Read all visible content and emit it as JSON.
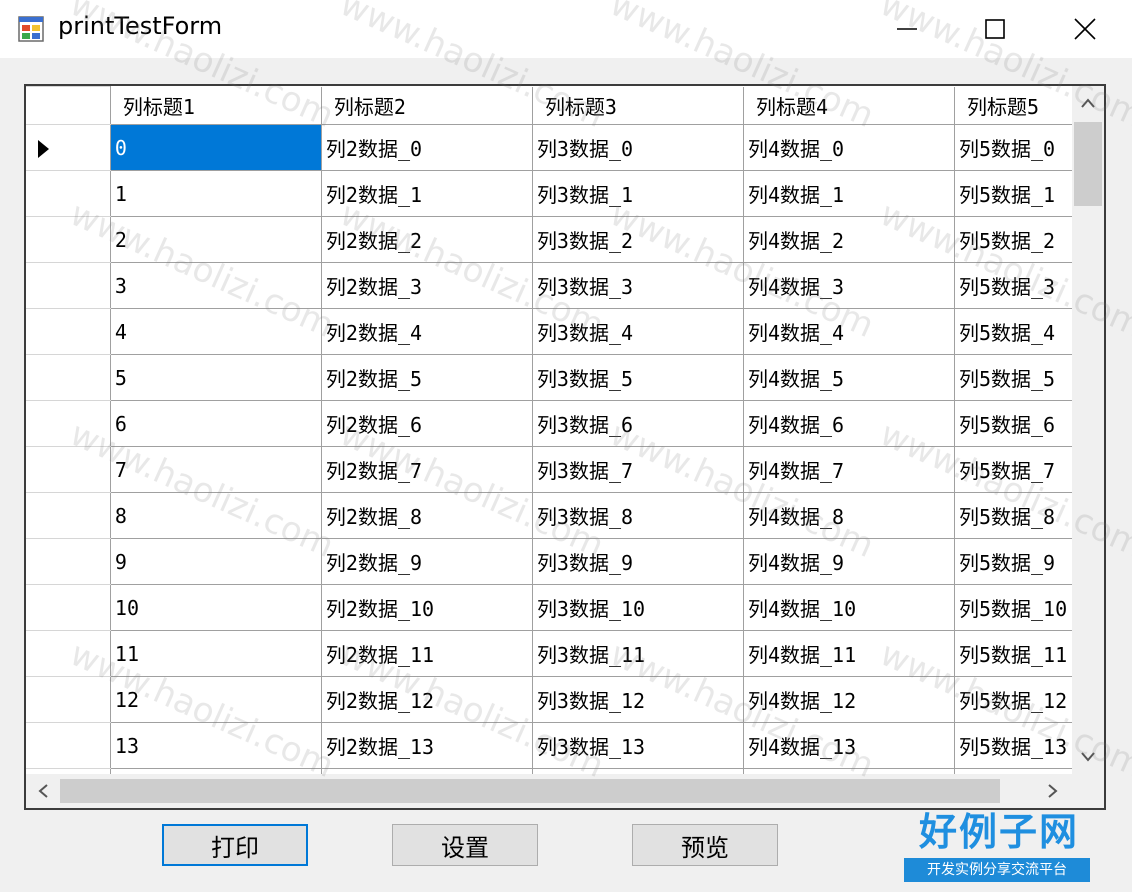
{
  "window": {
    "title": "printTestForm",
    "icons": {
      "app": "form-app-icon",
      "minimize": "minimize-icon",
      "maximize": "maximize-icon",
      "close": "close-icon"
    }
  },
  "grid": {
    "columns": [
      "列标题1",
      "列标题2",
      "列标题3",
      "列标题4",
      "列标题5"
    ],
    "current_row_marker": "row-pointer-icon",
    "rows": [
      [
        "0",
        "列2数据_0",
        "列3数据_0",
        "列4数据_0",
        "列5数据_0"
      ],
      [
        "1",
        "列2数据_1",
        "列3数据_1",
        "列4数据_1",
        "列5数据_1"
      ],
      [
        "2",
        "列2数据_2",
        "列3数据_2",
        "列4数据_2",
        "列5数据_2"
      ],
      [
        "3",
        "列2数据_3",
        "列3数据_3",
        "列4数据_3",
        "列5数据_3"
      ],
      [
        "4",
        "列2数据_4",
        "列3数据_4",
        "列4数据_4",
        "列5数据_4"
      ],
      [
        "5",
        "列2数据_5",
        "列3数据_5",
        "列4数据_5",
        "列5数据_5"
      ],
      [
        "6",
        "列2数据_6",
        "列3数据_6",
        "列4数据_6",
        "列5数据_6"
      ],
      [
        "7",
        "列2数据_7",
        "列3数据_7",
        "列4数据_7",
        "列5数据_7"
      ],
      [
        "8",
        "列2数据_8",
        "列3数据_8",
        "列4数据_8",
        "列5数据_8"
      ],
      [
        "9",
        "列2数据_9",
        "列3数据_9",
        "列4数据_9",
        "列5数据_9"
      ],
      [
        "10",
        "列2数据_10",
        "列3数据_10",
        "列4数据_10",
        "列5数据_10"
      ],
      [
        "11",
        "列2数据_11",
        "列3数据_11",
        "列4数据_11",
        "列5数据_11"
      ],
      [
        "12",
        "列2数据_12",
        "列3数据_12",
        "列4数据_12",
        "列5数据_12"
      ],
      [
        "13",
        "列2数据_13",
        "列3数据_13",
        "列4数据_13",
        "列5数据_13"
      ],
      [
        "",
        "",
        "",
        "",
        ""
      ]
    ],
    "selected_cell_color": "#0078d7"
  },
  "buttons": {
    "print_label": "打印",
    "settings_label": "设置",
    "preview_label": "预览"
  },
  "watermark": {
    "text": "www.haolizi.com",
    "logo_main": "好例子网",
    "logo_sub": "开发实例分享交流平台"
  },
  "colors": {
    "accent": "#0078d7",
    "logo": "#1f8fe0"
  }
}
